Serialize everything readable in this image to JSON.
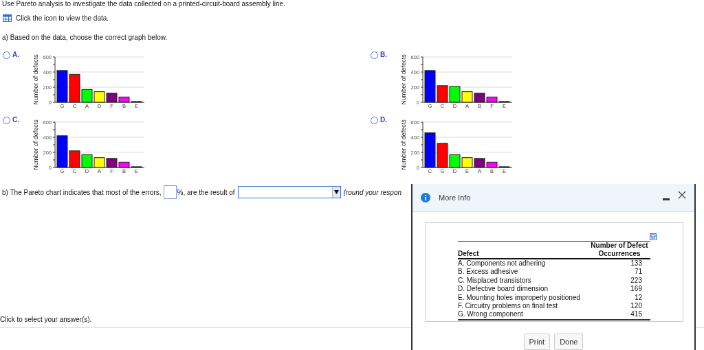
{
  "intro": "Use Pareto analysis to investigate the data collected on a printed-circuit-board assembly line.",
  "data_link": {
    "label": "Click the icon to view the data."
  },
  "part_a": {
    "prompt": "a) Based on the data, choose the correct graph below.",
    "options": [
      {
        "label": "A.",
        "selected": false,
        "chart_data": {
          "type": "bar",
          "ylabel": "Number of defects",
          "categories": [
            "G",
            "C",
            "A",
            "D",
            "F",
            "B",
            "E"
          ],
          "colors": [
            "#0000ff",
            "#ff0000",
            "#00ff00",
            "#ffff00",
            "#800080",
            "#ff00ff",
            "#006666"
          ],
          "values": [
            420,
            370,
            170,
            140,
            120,
            70,
            10
          ],
          "ylim": [
            0,
            600
          ],
          "yticks": [
            0,
            200,
            400,
            600
          ]
        }
      },
      {
        "label": "B.",
        "selected": false,
        "chart_data": {
          "type": "bar",
          "ylabel": "Number of defects",
          "categories": [
            "G",
            "C",
            "D",
            "A",
            "B",
            "F",
            "E"
          ],
          "colors": [
            "#0000ff",
            "#ff0000",
            "#00ff00",
            "#ffff00",
            "#800080",
            "#ff00ff",
            "#006666"
          ],
          "values": [
            420,
            220,
            210,
            140,
            120,
            70,
            10
          ],
          "ylim": [
            0,
            600
          ],
          "yticks": [
            0,
            200,
            400,
            600
          ]
        }
      },
      {
        "label": "C.",
        "selected": false,
        "chart_data": {
          "type": "bar",
          "ylabel": "Number of defects",
          "categories": [
            "G",
            "C",
            "D",
            "A",
            "F",
            "B",
            "E"
          ],
          "colors": [
            "#0000ff",
            "#ff0000",
            "#00ff00",
            "#ffff00",
            "#800080",
            "#ff00ff",
            "#006666"
          ],
          "values": [
            420,
            220,
            170,
            130,
            120,
            70,
            10
          ],
          "ylim": [
            0,
            600
          ],
          "yticks": [
            0,
            200,
            400,
            600
          ]
        }
      },
      {
        "label": "D.",
        "selected": false,
        "chart_data": {
          "type": "bar",
          "ylabel": "Number of defects",
          "categories": [
            "C",
            "G",
            "D",
            "E",
            "A",
            "B",
            "E"
          ],
          "colors": [
            "#0000ff",
            "#ff0000",
            "#00ff00",
            "#ffff00",
            "#800080",
            "#ff00ff",
            "#006666"
          ],
          "values": [
            460,
            320,
            170,
            130,
            120,
            70,
            10
          ],
          "ylim": [
            0,
            600
          ],
          "yticks": [
            0,
            200,
            400,
            600
          ]
        }
      }
    ]
  },
  "part_b": {
    "prefix": "b) The Pareto chart indicates that most of the errors,",
    "middle": "%, are the result of",
    "suffix": "(round your respon"
  },
  "footer": "Click to select your answer(s).",
  "dialog": {
    "title": "More Info",
    "table": {
      "columns": [
        "Defect",
        "Number of Defect Occurrences"
      ],
      "rows": [
        [
          "A. Components not adhering",
          "133"
        ],
        [
          "B. Excess adhesive",
          "71"
        ],
        [
          "C. Misplaced transistors",
          "223"
        ],
        [
          "D. Defective board dimension",
          "169"
        ],
        [
          "E. Mounting holes improperly positioned",
          "12"
        ],
        [
          "F. Circuitry problems on final test",
          "120"
        ],
        [
          "G. Wrong component",
          "415"
        ]
      ]
    },
    "buttons": [
      "Print",
      "Done"
    ]
  }
}
